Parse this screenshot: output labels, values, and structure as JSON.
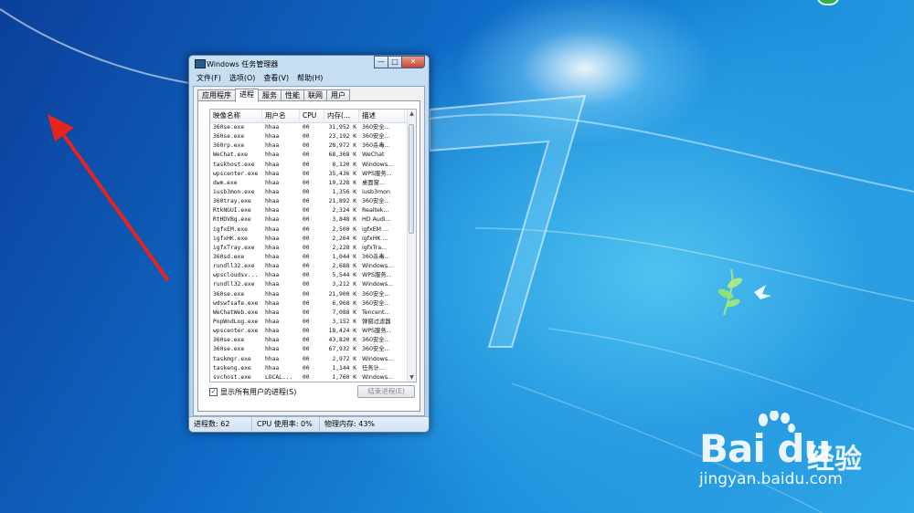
{
  "window": {
    "title": "Windows 任务管理器",
    "buttons": {
      "minimize": "—",
      "maximize": "□",
      "close": "✕"
    }
  },
  "menu": [
    "文件(F)",
    "选项(O)",
    "查看(V)",
    "帮助(H)"
  ],
  "tabs": [
    "应用程序",
    "进程",
    "服务",
    "性能",
    "联网",
    "用户"
  ],
  "active_tab": "进程",
  "columns": [
    "映像名称",
    "用户名",
    "CPU",
    "内存(...",
    "描述"
  ],
  "processes": [
    [
      "360se.exe",
      "hhaa",
      "00",
      "31,952 K",
      "360安全..."
    ],
    [
      "360se.exe",
      "hhaa",
      "00",
      "23,192 K",
      "360安全..."
    ],
    [
      "360rp.exe",
      "hhaa",
      "00",
      "28,972 K",
      "360杀毒..."
    ],
    [
      "WeChat.exe",
      "hhaa",
      "00",
      "68,368 K",
      "WeChat"
    ],
    [
      "taskhost.exe",
      "hhaa",
      "00",
      "8,120 K",
      "Windows..."
    ],
    [
      "wpscenter.exe",
      "hhaa",
      "00",
      "35,436 K",
      "WPS服务..."
    ],
    [
      "dwm.exe",
      "hhaa",
      "00",
      "19,228 K",
      "桌面窗..."
    ],
    [
      "iusb3mon.exe",
      "hhaa",
      "00",
      "1,356 K",
      "iusb3mon"
    ],
    [
      "360tray.exe",
      "hhaa",
      "00",
      "21,892 K",
      "360安全..."
    ],
    [
      "RtkNGUI.exe",
      "hhaa",
      "00",
      "2,324 K",
      "Realtek..."
    ],
    [
      "RtHDVBg.exe",
      "hhaa",
      "00",
      "3,848 K",
      "HD Audi..."
    ],
    [
      "igfxEM.exe",
      "hhaa",
      "00",
      "2,500 K",
      "igfxEM ..."
    ],
    [
      "igfxHK.exe",
      "hhaa",
      "00",
      "2,264 K",
      "igfxHK ..."
    ],
    [
      "igfxTray.exe",
      "hhaa",
      "00",
      "2,228 K",
      "igfxTra..."
    ],
    [
      "360sd.exe",
      "hhaa",
      "00",
      "1,044 K",
      "360杀毒..."
    ],
    [
      "rundll32.exe",
      "hhaa",
      "00",
      "2,688 K",
      "Windows..."
    ],
    [
      "wpscloudsv...",
      "hhaa",
      "00",
      "5,544 K",
      "WPS服务..."
    ],
    [
      "rundll32.exe",
      "hhaa",
      "00",
      "3,212 K",
      "Windows..."
    ],
    [
      "360se.exe",
      "hhaa",
      "00",
      "21,900 K",
      "360安全..."
    ],
    [
      "wdswfsafe.exe",
      "hhaa",
      "00",
      "6,968 K",
      "360安全..."
    ],
    [
      "WeChatWeb.exe",
      "hhaa",
      "00",
      "7,088 K",
      "Tencent..."
    ],
    [
      "PopWndLog.exe",
      "hhaa",
      "00",
      "3,152 K",
      "弹窗过滤器"
    ],
    [
      "wpscenter.exe",
      "hhaa",
      "00",
      "18,424 K",
      "WPS服务..."
    ],
    [
      "360se.exe",
      "hhaa",
      "00",
      "43,820 K",
      "360安全..."
    ],
    [
      "360se.exe",
      "hhaa",
      "00",
      "67,932 K",
      "360安全..."
    ],
    [
      "taskmgr.exe",
      "hhaa",
      "00",
      "2,972 K",
      "Windows..."
    ],
    [
      "taskeng.exe",
      "hhaa",
      "00",
      "1,144 K",
      "任务计..."
    ],
    [
      "svchost.exe",
      "LOCAL...",
      "00",
      "1,760 K",
      "Windows..."
    ]
  ],
  "show_all_label": "显示所有用户的进程(S)",
  "show_all_checked": true,
  "end_process_label": "结束进程(E)",
  "status": {
    "processes": "进程数: 62",
    "cpu": "CPU 使用率: 0%",
    "memory": "物理内存: 43%"
  },
  "watermark": {
    "logo": "Bai du",
    "cn": "经验",
    "url": "jingyan.baidu.com"
  },
  "colors": {
    "arrow": "#e8231e",
    "desktop": "#1470c8"
  }
}
